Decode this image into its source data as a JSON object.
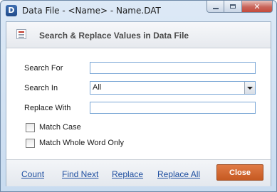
{
  "window": {
    "app_icon_letter": "D",
    "title": "Data File - <Name> - Name.DAT"
  },
  "header": {
    "title": "Search & Replace Values in Data File"
  },
  "form": {
    "search_for": {
      "label": "Search For",
      "value": ""
    },
    "search_in": {
      "label": "Search In",
      "selected": "All"
    },
    "replace_with": {
      "label": "Replace With",
      "value": ""
    },
    "match_case": {
      "label": "Match Case",
      "checked": false
    },
    "match_whole_word": {
      "label": "Match Whole Word Only",
      "checked": false
    }
  },
  "footer": {
    "count": "Count",
    "find_next": "Find Next",
    "replace": "Replace",
    "replace_all": "Replace All",
    "close": "Close"
  },
  "colors": {
    "close_button": "#c65a22",
    "link": "#1f4fa0",
    "input_border": "#7aa7d6"
  }
}
